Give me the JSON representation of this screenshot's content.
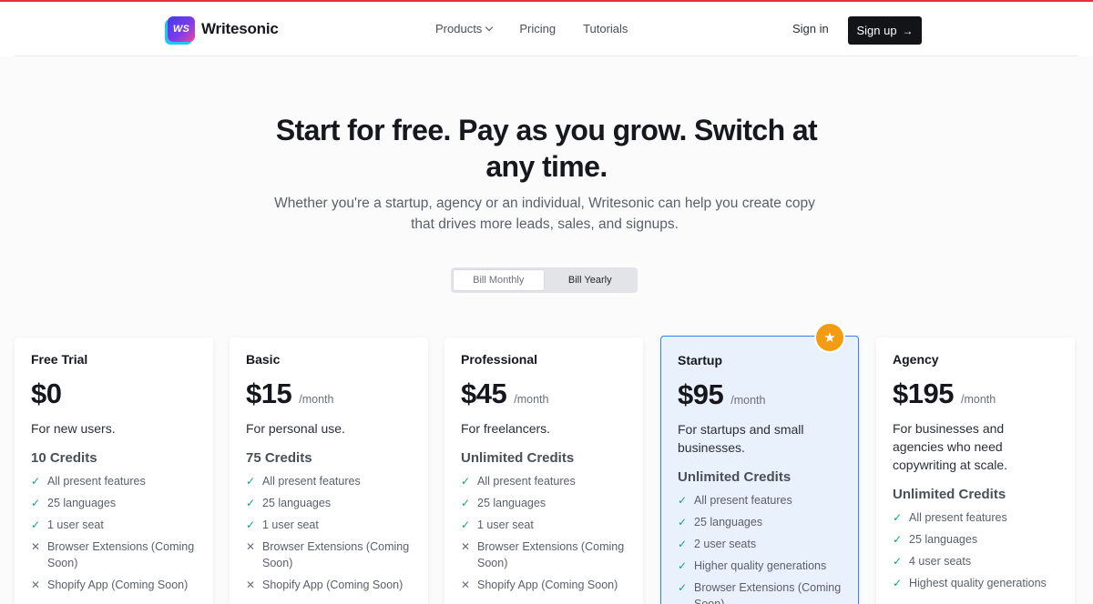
{
  "brand": {
    "logo_mark": "WS",
    "name": "Writesonic",
    "accent": "#e2333b"
  },
  "nav": {
    "items": [
      {
        "label": "Products",
        "has_dropdown": true
      },
      {
        "label": "Pricing",
        "has_dropdown": false
      },
      {
        "label": "Tutorials",
        "has_dropdown": false
      }
    ],
    "signin": "Sign in",
    "signup": "Sign up",
    "signup_icon": "arrow-right-icon"
  },
  "hero": {
    "title": "Start for free. Pay as you grow. Switch at any time.",
    "subtitle": "Whether you're a startup, agency or an individual, Writesonic can help you create copy that drives more leads, sales, and signups."
  },
  "billing_toggle": {
    "monthly": "Bill Monthly",
    "yearly": "Bill Yearly"
  },
  "plans": [
    {
      "name": "Free Trial",
      "currency": "$",
      "price": "0",
      "period": "",
      "description": "For new users.",
      "credits": "10 Credits",
      "features": [
        {
          "text": "All present features",
          "included": true
        },
        {
          "text": "25 languages",
          "included": true
        },
        {
          "text": "1 user seat",
          "included": true
        },
        {
          "text": "Browser Extensions (Coming Soon)",
          "included": false
        },
        {
          "text": "Shopify App (Coming Soon)",
          "included": false
        }
      ]
    },
    {
      "name": "Basic",
      "currency": "$",
      "price": "15",
      "period": "/month",
      "description": "For personal use.",
      "credits": "75 Credits",
      "features": [
        {
          "text": "All present features",
          "included": true
        },
        {
          "text": "25 languages",
          "included": true
        },
        {
          "text": "1 user seat",
          "included": true
        },
        {
          "text": "Browser Extensions (Coming Soon)",
          "included": false
        },
        {
          "text": "Shopify App (Coming Soon)",
          "included": false
        }
      ]
    },
    {
      "name": "Professional",
      "currency": "$",
      "price": "45",
      "period": "/month",
      "description": "For freelancers.",
      "credits": "Unlimited Credits",
      "features": [
        {
          "text": "All present features",
          "included": true
        },
        {
          "text": "25 languages",
          "included": true
        },
        {
          "text": "1 user seat",
          "included": true
        },
        {
          "text": "Browser Extensions (Coming Soon)",
          "included": false
        },
        {
          "text": "Shopify App (Coming Soon)",
          "included": false
        }
      ]
    },
    {
      "name": "Startup",
      "currency": "$",
      "price": "95",
      "period": "/month",
      "description": "For startups and small businesses.",
      "credits": "Unlimited Credits",
      "featured": true,
      "features": [
        {
          "text": "All present features",
          "included": true
        },
        {
          "text": "25 languages",
          "included": true
        },
        {
          "text": "2 user seats",
          "included": true
        },
        {
          "text": "Higher quality generations",
          "included": true
        },
        {
          "text": "Browser Extensions (Coming Soon)",
          "included": true
        }
      ]
    },
    {
      "name": "Agency",
      "currency": "$",
      "price": "195",
      "period": "/month",
      "description": "For businesses and agencies who need copywriting at scale.",
      "credits": "Unlimited Credits",
      "features": [
        {
          "text": "All present features",
          "included": true
        },
        {
          "text": "25 languages",
          "included": true
        },
        {
          "text": "4 user seats",
          "included": true
        },
        {
          "text": "Highest quality generations",
          "included": true
        }
      ]
    }
  ],
  "featured_badge_icon": "star-icon",
  "colors": {
    "check": "#16a37f",
    "featured_border": "#3b7ce6",
    "badge": "#f39c12",
    "cta": "#131417"
  }
}
